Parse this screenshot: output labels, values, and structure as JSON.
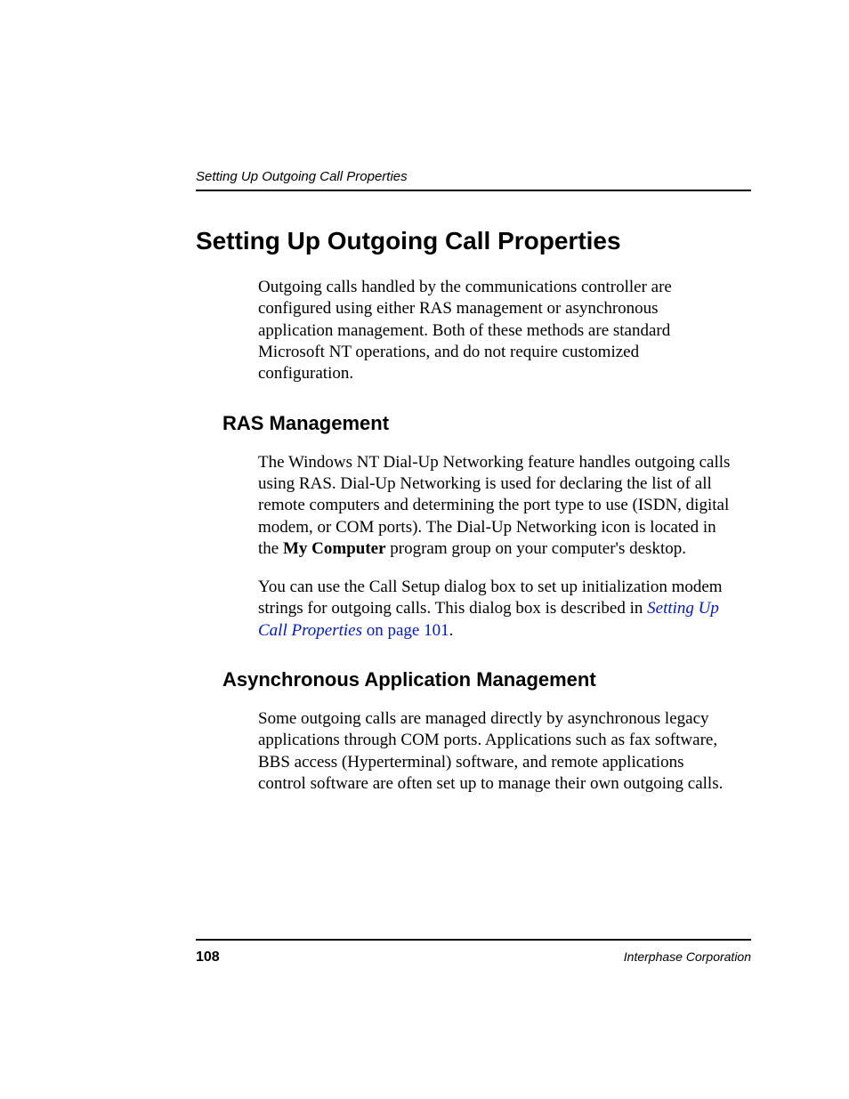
{
  "header": {
    "running_head": "Setting Up Outgoing Call Properties"
  },
  "main": {
    "title": "Setting Up Outgoing Call Properties",
    "intro": "Outgoing calls handled by the communications controller are configured using either RAS management or asynchronous application management. Both of these methods are standard Microsoft NT operations, and do not require customized configuration.",
    "section1": {
      "heading": "RAS Management",
      "p1_a": "The Windows NT Dial-Up Networking feature handles outgoing calls using RAS. Dial-Up Networking is used for declaring the list of all remote computers and determining the port type to use (ISDN, digital modem, or COM ports). The Dial-Up Networking icon is located in the ",
      "p1_bold": "My Computer",
      "p1_b": " program group on your computer's desktop.",
      "p2_a": "You can use the Call Setup dialog box to set up initialization modem strings for outgoing calls. This dialog box is described in ",
      "p2_link_italic": "Setting Up Call Properties",
      "p2_link_tail": " on page 101",
      "p2_b": "."
    },
    "section2": {
      "heading": "Asynchronous Application Management",
      "p1": "Some outgoing calls are managed directly by asynchronous legacy applications through COM ports. Applications such as fax software, BBS access (Hyperterminal) software, and remote applications control software are often set up to manage their own outgoing calls."
    }
  },
  "footer": {
    "page_number": "108",
    "corp": "Interphase Corporation"
  }
}
